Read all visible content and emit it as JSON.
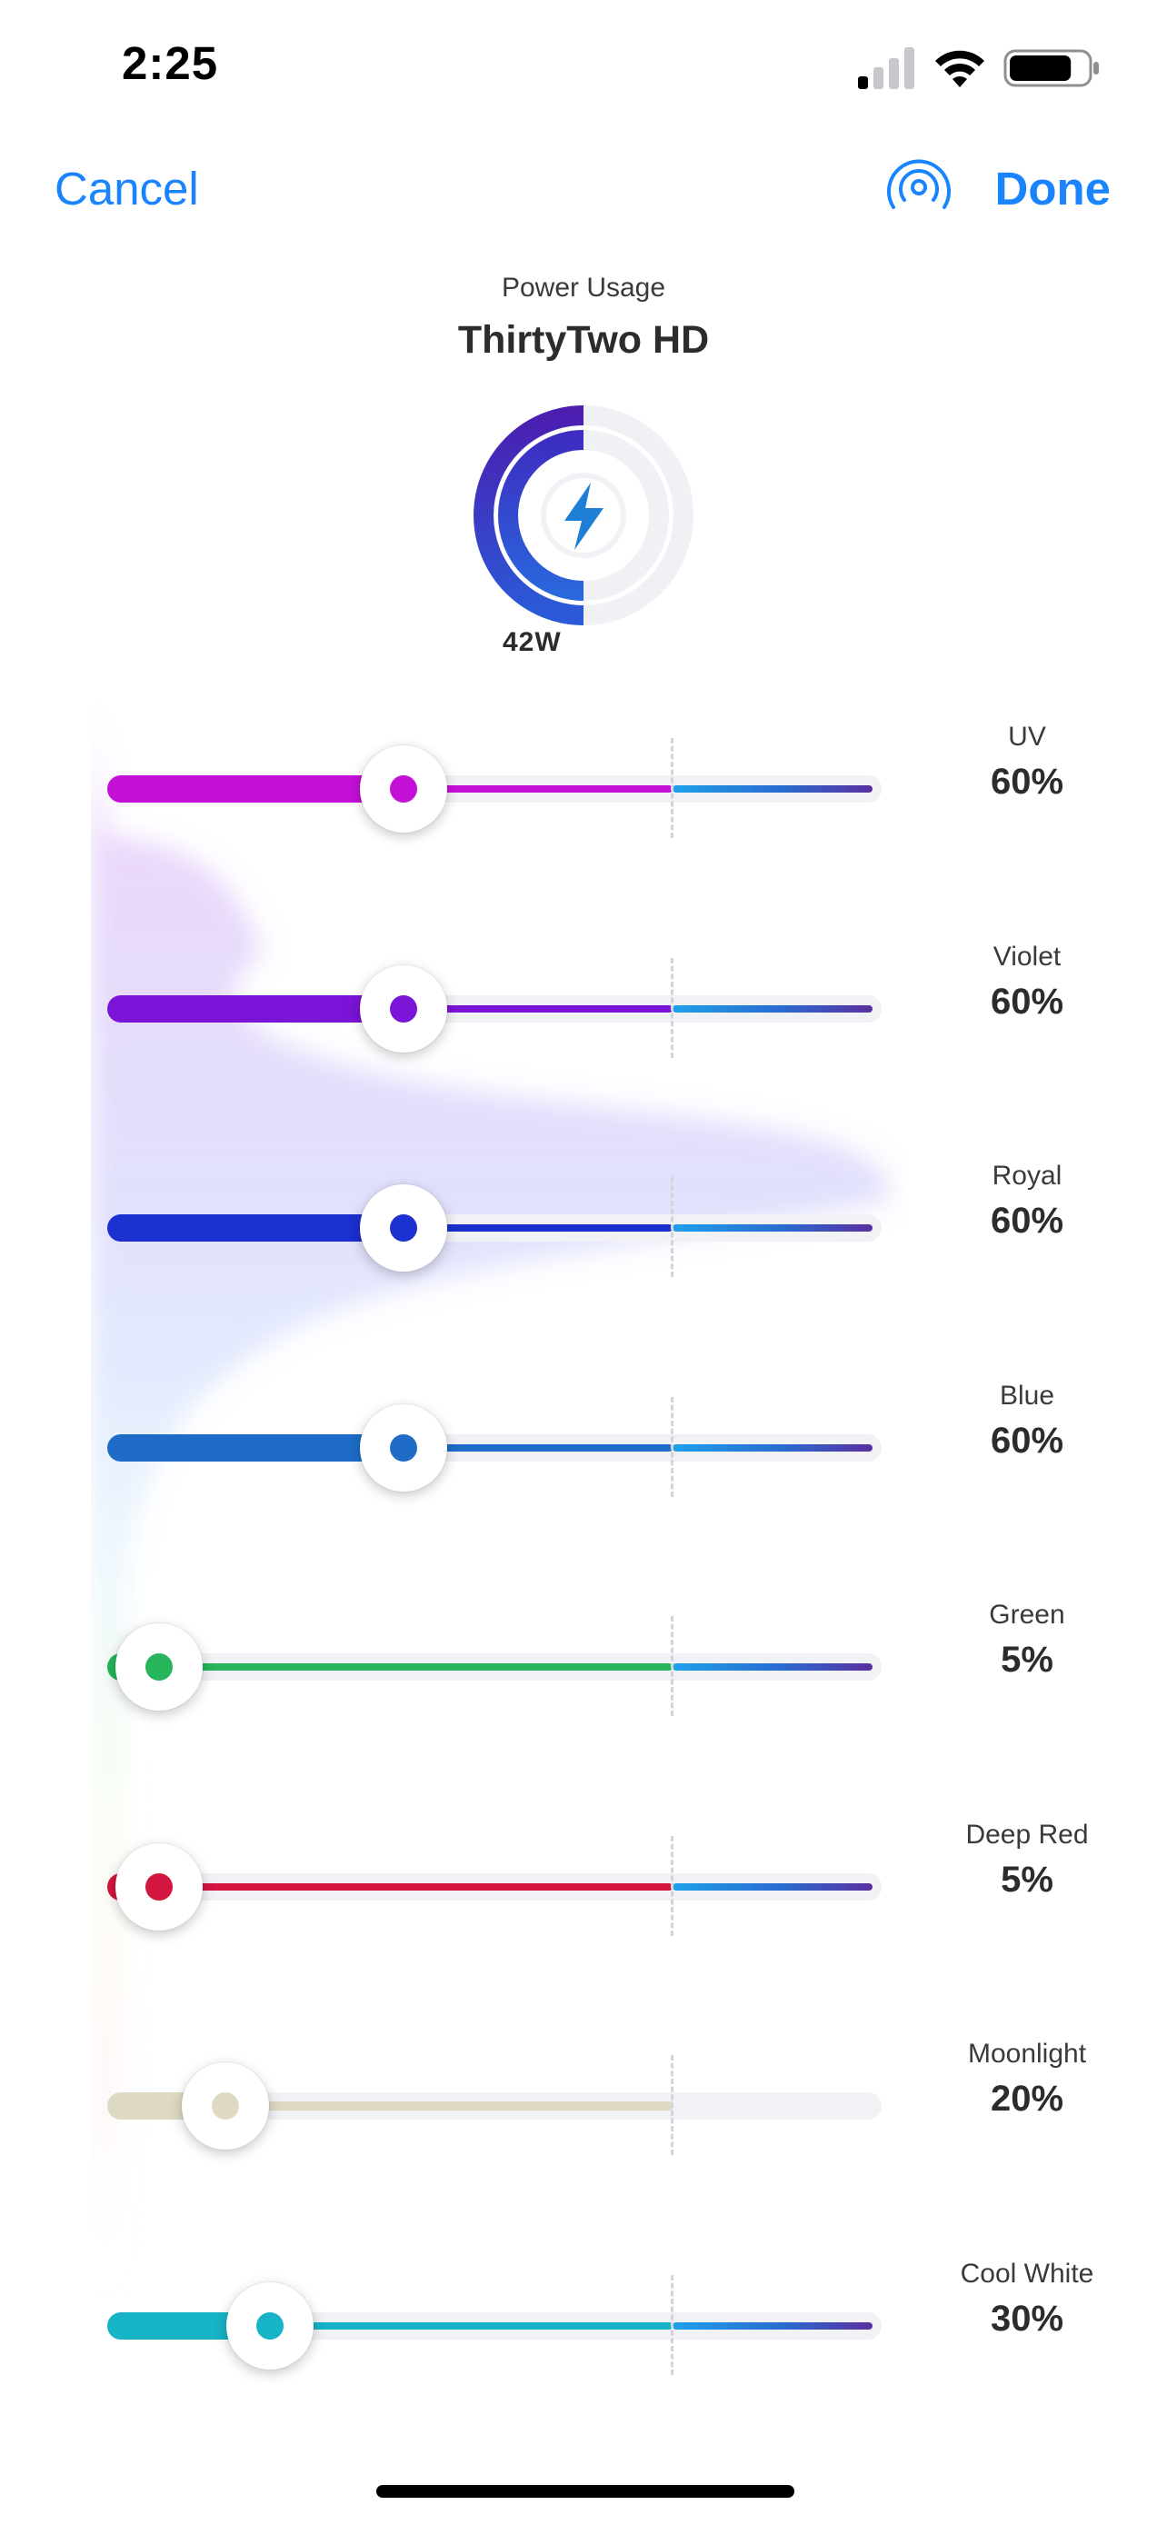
{
  "status_bar": {
    "time": "2:25",
    "signal_bars": 1,
    "battery_level": 0.8
  },
  "nav": {
    "cancel_label": "Cancel",
    "done_label": "Done",
    "broadcast_icon": "broadcast-icon"
  },
  "header": {
    "title_small": "Power Usage",
    "device_name": "ThirtyTwo HD"
  },
  "gauge": {
    "watts_label": "42W",
    "fraction": 0.5,
    "icon": "lightning-bolt-icon"
  },
  "accent_color": "#1a84ff",
  "channels": [
    {
      "name": "UV",
      "value_label": "60%",
      "value": 60,
      "color": "#c30fd6",
      "boost": true
    },
    {
      "name": "Violet",
      "value_label": "60%",
      "value": 60,
      "color": "#7a14d6",
      "boost": true
    },
    {
      "name": "Royal",
      "value_label": "60%",
      "value": 60,
      "color": "#1c2fcf",
      "boost": true
    },
    {
      "name": "Blue",
      "value_label": "60%",
      "value": 60,
      "color": "#1e6cc8",
      "boost": true
    },
    {
      "name": "Green",
      "value_label": "5%",
      "value": 5,
      "color": "#26b55a",
      "boost": true
    },
    {
      "name": "Deep Red",
      "value_label": "5%",
      "value": 5,
      "color": "#d3153f",
      "boost": true
    },
    {
      "name": "Moonlight",
      "value_label": "20%",
      "value": 20,
      "color": "#ddd9c2",
      "boost": false
    },
    {
      "name": "Cool White",
      "value_label": "30%",
      "value": 30,
      "color": "#17b3c6",
      "boost": true
    }
  ]
}
